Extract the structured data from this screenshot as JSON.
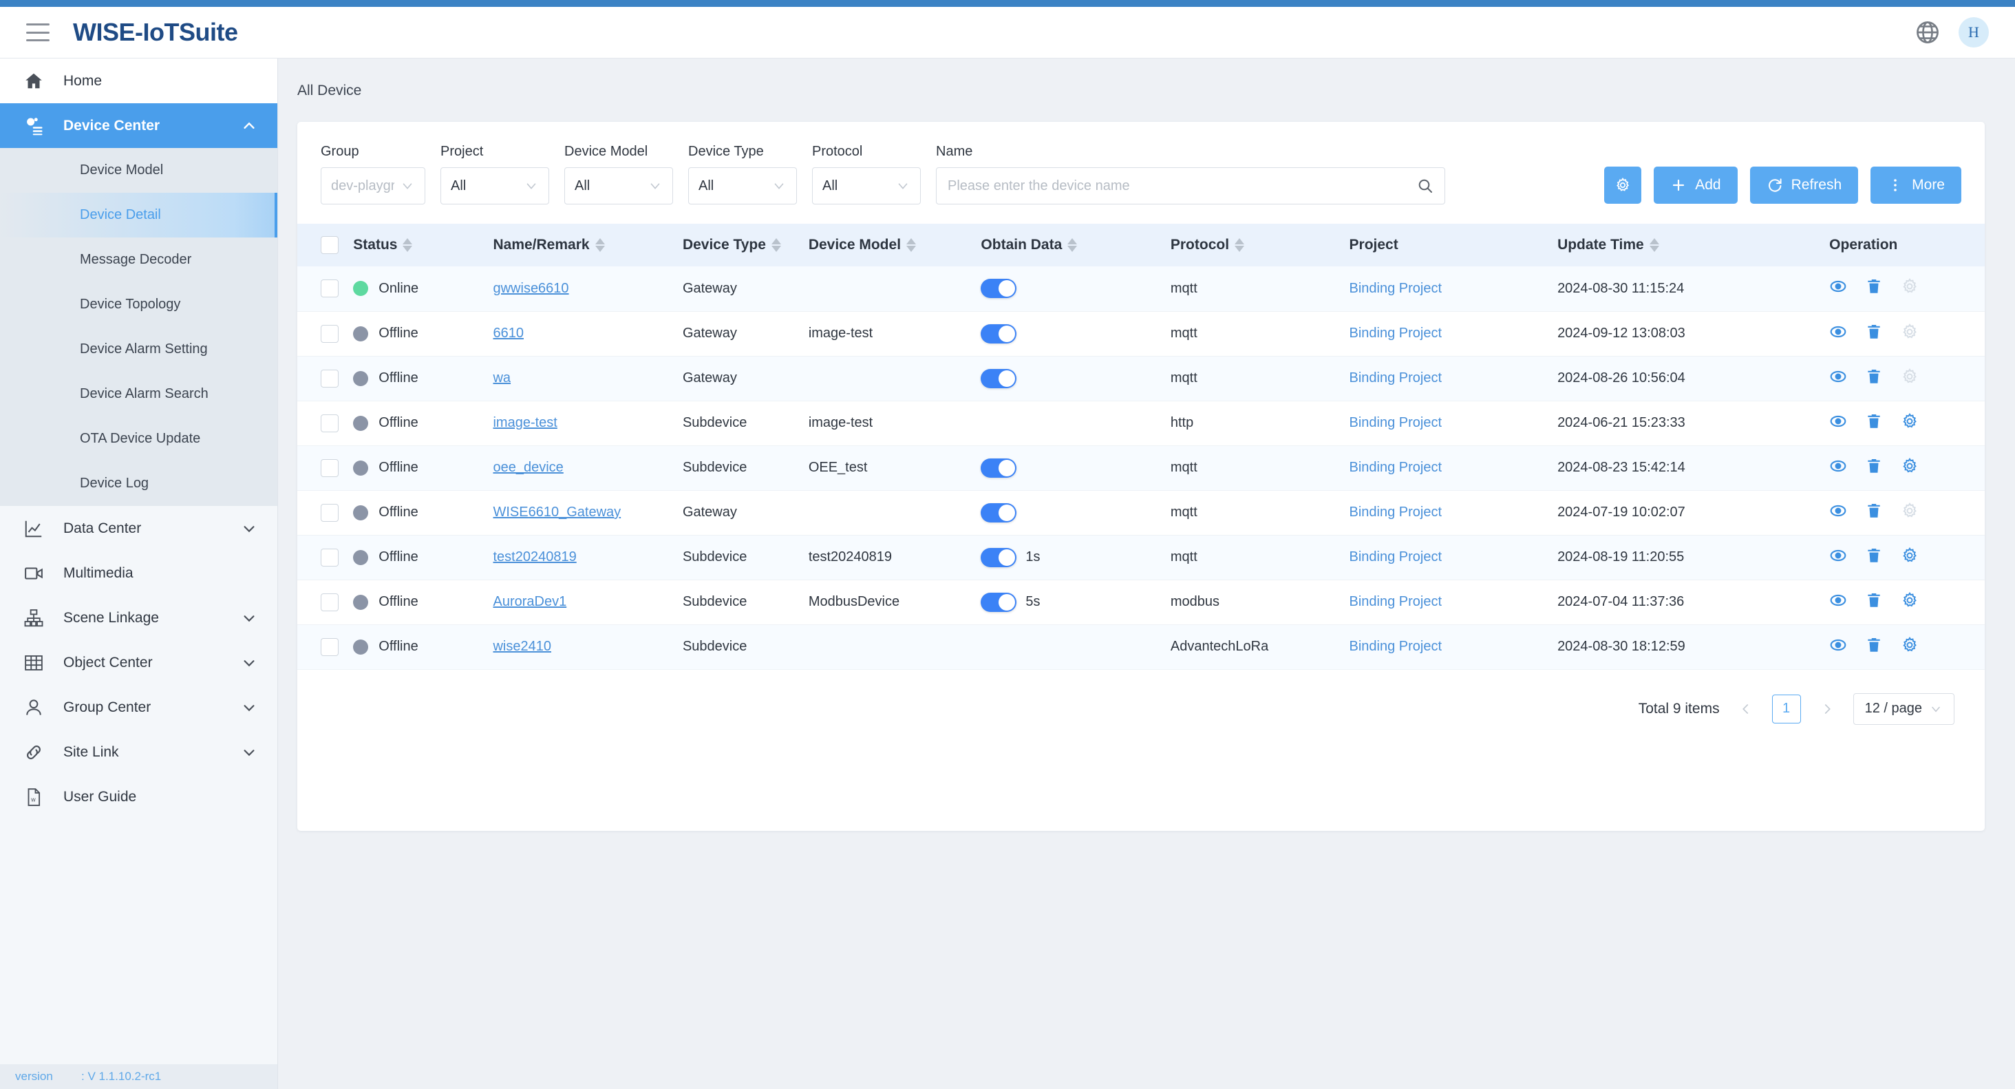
{
  "header": {
    "brand": "WISE-IoTSuite",
    "menu_icon": "hamburger-icon",
    "language_icon": "globe-icon",
    "avatar_initial": "H"
  },
  "sidebar": {
    "items": [
      {
        "label": "Home",
        "icon": "home-icon",
        "expandable": false,
        "active": false
      },
      {
        "label": "Device Center",
        "icon": "device-center-icon",
        "expandable": true,
        "expanded": true,
        "active": true
      },
      {
        "label": "Data Center",
        "icon": "chart-icon",
        "expandable": true,
        "expanded": false,
        "active": false
      },
      {
        "label": "Multimedia",
        "icon": "video-icon",
        "expandable": false,
        "active": false
      },
      {
        "label": "Scene Linkage",
        "icon": "sitemap-icon",
        "expandable": true,
        "expanded": false,
        "active": false
      },
      {
        "label": "Object Center",
        "icon": "table-icon",
        "expandable": true,
        "expanded": false,
        "active": false
      },
      {
        "label": "Group Center",
        "icon": "user-icon",
        "expandable": true,
        "expanded": false,
        "active": false
      },
      {
        "label": "Site Link",
        "icon": "link-icon",
        "expandable": true,
        "expanded": false,
        "active": false
      },
      {
        "label": "User Guide",
        "icon": "document-icon",
        "expandable": false,
        "active": false
      }
    ],
    "device_center_submenu": [
      {
        "label": "Device Model",
        "selected": false
      },
      {
        "label": "Device Detail",
        "selected": true
      },
      {
        "label": "Message Decoder",
        "selected": false
      },
      {
        "label": "Device Topology",
        "selected": false
      },
      {
        "label": "Device Alarm Setting",
        "selected": false
      },
      {
        "label": "Device Alarm Search",
        "selected": false
      },
      {
        "label": "OTA Device Update",
        "selected": false
      },
      {
        "label": "Device Log",
        "selected": false
      }
    ],
    "version_label": "version",
    "version_value": ": V 1.1.10.2-rc1"
  },
  "breadcrumb": "All Device",
  "filters": [
    {
      "label": "Group",
      "value": "dev-playgro...",
      "disabled": true,
      "width": "w-group"
    },
    {
      "label": "Project",
      "value": "All",
      "disabled": false,
      "width": "w-std"
    },
    {
      "label": "Device Model",
      "value": "All",
      "disabled": false,
      "width": "w-std"
    },
    {
      "label": "Device Type",
      "value": "All",
      "disabled": false,
      "width": "w-std"
    },
    {
      "label": "Protocol",
      "value": "All",
      "disabled": false,
      "width": "w-std"
    }
  ],
  "search": {
    "label": "Name",
    "value": "",
    "placeholder": "Please enter the device name",
    "icon": "search-icon"
  },
  "toolbar": {
    "settings_icon": "gear-icon",
    "add_label": "Add",
    "add_icon": "plus-icon",
    "refresh_label": "Refresh",
    "refresh_icon": "refresh-icon",
    "more_label": "More",
    "more_icon": "vertical-dots-icon"
  },
  "table": {
    "columns": [
      {
        "key": "checkbox",
        "label": "",
        "sortable": false,
        "cls": "c-chk"
      },
      {
        "key": "status",
        "label": "Status",
        "sortable": true,
        "cls": "c-status"
      },
      {
        "key": "name",
        "label": "Name/Remark",
        "sortable": true,
        "cls": "c-name"
      },
      {
        "key": "device_type",
        "label": "Device Type",
        "sortable": true,
        "cls": "c-dtype"
      },
      {
        "key": "device_model",
        "label": "Device Model",
        "sortable": true,
        "cls": "c-dmodel"
      },
      {
        "key": "obtain_data",
        "label": "Obtain Data",
        "sortable": true,
        "cls": "c-obtain"
      },
      {
        "key": "protocol",
        "label": "Protocol",
        "sortable": true,
        "cls": "c-proto"
      },
      {
        "key": "project",
        "label": "Project",
        "sortable": false,
        "cls": "c-project"
      },
      {
        "key": "update_time",
        "label": "Update Time",
        "sortable": true,
        "cls": "c-time"
      },
      {
        "key": "operation",
        "label": "Operation",
        "sortable": false,
        "cls": "c-oper"
      }
    ],
    "rows": [
      {
        "checked": false,
        "status": "Online",
        "name": "gwwise6610",
        "device_type": "Gateway",
        "device_model": "",
        "obtain_data": true,
        "interval": "",
        "protocol": "mqtt",
        "project": "Binding Project",
        "update_time": "2024-08-30 11:15:24",
        "gear_enabled": false
      },
      {
        "checked": false,
        "status": "Offline",
        "name": "6610",
        "device_type": "Gateway",
        "device_model": "image-test",
        "obtain_data": true,
        "interval": "",
        "protocol": "mqtt",
        "project": "Binding Project",
        "update_time": "2024-09-12 13:08:03",
        "gear_enabled": false
      },
      {
        "checked": false,
        "status": "Offline",
        "name": "wa",
        "device_type": "Gateway",
        "device_model": "",
        "obtain_data": true,
        "interval": "",
        "protocol": "mqtt",
        "project": "Binding Project",
        "update_time": "2024-08-26 10:56:04",
        "gear_enabled": false
      },
      {
        "checked": false,
        "status": "Offline",
        "name": "image-test",
        "device_type": "Subdevice",
        "device_model": "image-test",
        "obtain_data": false,
        "interval": "",
        "protocol": "http",
        "project": "Binding Project",
        "update_time": "2024-06-21 15:23:33",
        "gear_enabled": true
      },
      {
        "checked": false,
        "status": "Offline",
        "name": "oee_device",
        "device_type": "Subdevice",
        "device_model": "OEE_test",
        "obtain_data": true,
        "interval": "",
        "protocol": "mqtt",
        "project": "Binding Project",
        "update_time": "2024-08-23 15:42:14",
        "gear_enabled": true
      },
      {
        "checked": false,
        "status": "Offline",
        "name": "WISE6610_Gateway",
        "device_type": "Gateway",
        "device_model": "",
        "obtain_data": true,
        "interval": "",
        "protocol": "mqtt",
        "project": "Binding Project",
        "update_time": "2024-07-19 10:02:07",
        "gear_enabled": false
      },
      {
        "checked": false,
        "status": "Offline",
        "name": "test20240819",
        "device_type": "Subdevice",
        "device_model": "test20240819",
        "obtain_data": true,
        "interval": "1s",
        "protocol": "mqtt",
        "project": "Binding Project",
        "update_time": "2024-08-19 11:20:55",
        "gear_enabled": true
      },
      {
        "checked": false,
        "status": "Offline",
        "name": "AuroraDev1",
        "device_type": "Subdevice",
        "device_model": "ModbusDevice",
        "obtain_data": true,
        "interval": "5s",
        "protocol": "modbus",
        "project": "Binding Project",
        "update_time": "2024-07-04 11:37:36",
        "gear_enabled": true
      },
      {
        "checked": false,
        "status": "Offline",
        "name": "wise2410",
        "device_type": "Subdevice",
        "device_model": "",
        "obtain_data": false,
        "interval": "",
        "protocol": "AdvantechLoRa",
        "project": "Binding Project",
        "update_time": "2024-08-30 18:12:59",
        "gear_enabled": true
      }
    ],
    "operation_icons": [
      "eye-icon",
      "trash-icon",
      "gear-icon"
    ]
  },
  "pagination": {
    "total_text": "Total 9 items",
    "prev_icon": "chevron-left-icon",
    "next_icon": "chevron-right-icon",
    "current_page": "1",
    "page_size": "12 / page"
  },
  "colors": {
    "accent": "#3b82c4",
    "primary_button": "#5aaaf2",
    "active_nav": "#4a9eeb",
    "link": "#4a90d9",
    "online": "#5ed9a0",
    "offline": "#8b94a6",
    "switch_on": "#3b82f6",
    "brand_text": "#1f4b85"
  }
}
